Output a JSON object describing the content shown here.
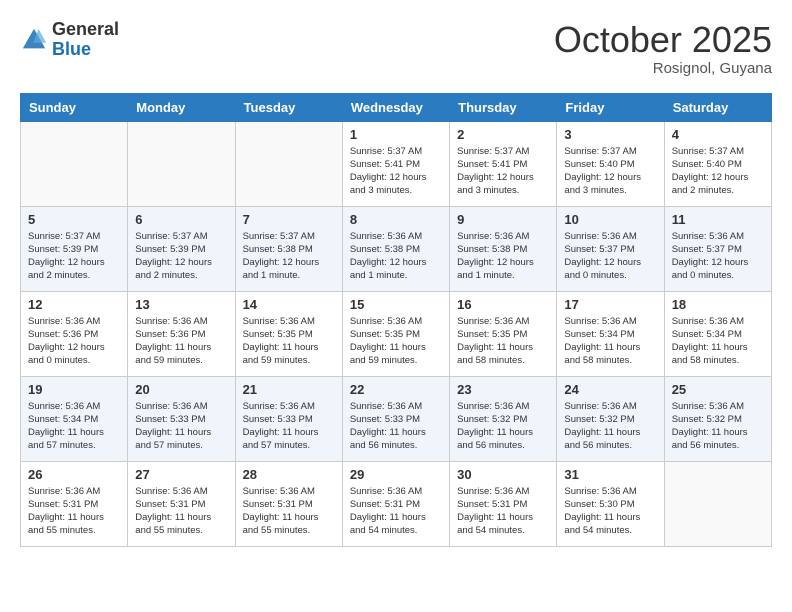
{
  "header": {
    "logo_general": "General",
    "logo_blue": "Blue",
    "month": "October 2025",
    "location": "Rosignol, Guyana"
  },
  "weekdays": [
    "Sunday",
    "Monday",
    "Tuesday",
    "Wednesday",
    "Thursday",
    "Friday",
    "Saturday"
  ],
  "weeks": [
    [
      {
        "day": "",
        "info": ""
      },
      {
        "day": "",
        "info": ""
      },
      {
        "day": "",
        "info": ""
      },
      {
        "day": "1",
        "info": "Sunrise: 5:37 AM\nSunset: 5:41 PM\nDaylight: 12 hours\nand 3 minutes."
      },
      {
        "day": "2",
        "info": "Sunrise: 5:37 AM\nSunset: 5:41 PM\nDaylight: 12 hours\nand 3 minutes."
      },
      {
        "day": "3",
        "info": "Sunrise: 5:37 AM\nSunset: 5:40 PM\nDaylight: 12 hours\nand 3 minutes."
      },
      {
        "day": "4",
        "info": "Sunrise: 5:37 AM\nSunset: 5:40 PM\nDaylight: 12 hours\nand 2 minutes."
      }
    ],
    [
      {
        "day": "5",
        "info": "Sunrise: 5:37 AM\nSunset: 5:39 PM\nDaylight: 12 hours\nand 2 minutes."
      },
      {
        "day": "6",
        "info": "Sunrise: 5:37 AM\nSunset: 5:39 PM\nDaylight: 12 hours\nand 2 minutes."
      },
      {
        "day": "7",
        "info": "Sunrise: 5:37 AM\nSunset: 5:38 PM\nDaylight: 12 hours\nand 1 minute."
      },
      {
        "day": "8",
        "info": "Sunrise: 5:36 AM\nSunset: 5:38 PM\nDaylight: 12 hours\nand 1 minute."
      },
      {
        "day": "9",
        "info": "Sunrise: 5:36 AM\nSunset: 5:38 PM\nDaylight: 12 hours\nand 1 minute."
      },
      {
        "day": "10",
        "info": "Sunrise: 5:36 AM\nSunset: 5:37 PM\nDaylight: 12 hours\nand 0 minutes."
      },
      {
        "day": "11",
        "info": "Sunrise: 5:36 AM\nSunset: 5:37 PM\nDaylight: 12 hours\nand 0 minutes."
      }
    ],
    [
      {
        "day": "12",
        "info": "Sunrise: 5:36 AM\nSunset: 5:36 PM\nDaylight: 12 hours\nand 0 minutes."
      },
      {
        "day": "13",
        "info": "Sunrise: 5:36 AM\nSunset: 5:36 PM\nDaylight: 11 hours\nand 59 minutes."
      },
      {
        "day": "14",
        "info": "Sunrise: 5:36 AM\nSunset: 5:35 PM\nDaylight: 11 hours\nand 59 minutes."
      },
      {
        "day": "15",
        "info": "Sunrise: 5:36 AM\nSunset: 5:35 PM\nDaylight: 11 hours\nand 59 minutes."
      },
      {
        "day": "16",
        "info": "Sunrise: 5:36 AM\nSunset: 5:35 PM\nDaylight: 11 hours\nand 58 minutes."
      },
      {
        "day": "17",
        "info": "Sunrise: 5:36 AM\nSunset: 5:34 PM\nDaylight: 11 hours\nand 58 minutes."
      },
      {
        "day": "18",
        "info": "Sunrise: 5:36 AM\nSunset: 5:34 PM\nDaylight: 11 hours\nand 58 minutes."
      }
    ],
    [
      {
        "day": "19",
        "info": "Sunrise: 5:36 AM\nSunset: 5:34 PM\nDaylight: 11 hours\nand 57 minutes."
      },
      {
        "day": "20",
        "info": "Sunrise: 5:36 AM\nSunset: 5:33 PM\nDaylight: 11 hours\nand 57 minutes."
      },
      {
        "day": "21",
        "info": "Sunrise: 5:36 AM\nSunset: 5:33 PM\nDaylight: 11 hours\nand 57 minutes."
      },
      {
        "day": "22",
        "info": "Sunrise: 5:36 AM\nSunset: 5:33 PM\nDaylight: 11 hours\nand 56 minutes."
      },
      {
        "day": "23",
        "info": "Sunrise: 5:36 AM\nSunset: 5:32 PM\nDaylight: 11 hours\nand 56 minutes."
      },
      {
        "day": "24",
        "info": "Sunrise: 5:36 AM\nSunset: 5:32 PM\nDaylight: 11 hours\nand 56 minutes."
      },
      {
        "day": "25",
        "info": "Sunrise: 5:36 AM\nSunset: 5:32 PM\nDaylight: 11 hours\nand 56 minutes."
      }
    ],
    [
      {
        "day": "26",
        "info": "Sunrise: 5:36 AM\nSunset: 5:31 PM\nDaylight: 11 hours\nand 55 minutes."
      },
      {
        "day": "27",
        "info": "Sunrise: 5:36 AM\nSunset: 5:31 PM\nDaylight: 11 hours\nand 55 minutes."
      },
      {
        "day": "28",
        "info": "Sunrise: 5:36 AM\nSunset: 5:31 PM\nDaylight: 11 hours\nand 55 minutes."
      },
      {
        "day": "29",
        "info": "Sunrise: 5:36 AM\nSunset: 5:31 PM\nDaylight: 11 hours\nand 54 minutes."
      },
      {
        "day": "30",
        "info": "Sunrise: 5:36 AM\nSunset: 5:31 PM\nDaylight: 11 hours\nand 54 minutes."
      },
      {
        "day": "31",
        "info": "Sunrise: 5:36 AM\nSunset: 5:30 PM\nDaylight: 11 hours\nand 54 minutes."
      },
      {
        "day": "",
        "info": ""
      }
    ]
  ]
}
